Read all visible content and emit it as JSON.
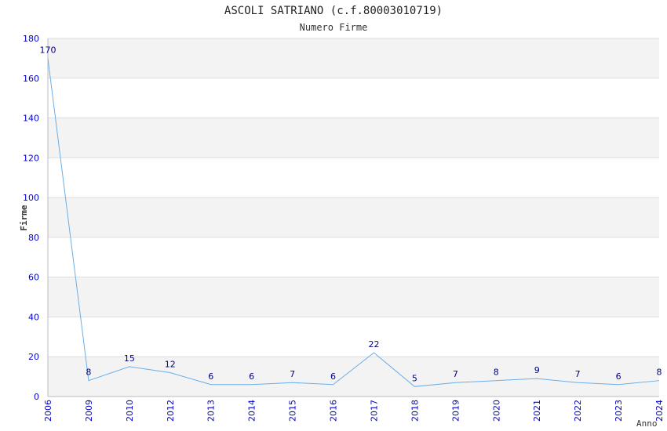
{
  "chart_data": {
    "type": "line",
    "title": "ASCOLI SATRIANO (c.f.80003010719)",
    "subtitle": "Numero Firme",
    "xlabel": "Anno",
    "ylabel": "Firme",
    "categories": [
      "2006",
      "2009",
      "2010",
      "2012",
      "2013",
      "2014",
      "2015",
      "2016",
      "2017",
      "2018",
      "2019",
      "2020",
      "2021",
      "2022",
      "2023",
      "2024"
    ],
    "values": [
      170,
      8,
      15,
      12,
      6,
      6,
      7,
      6,
      22,
      5,
      7,
      8,
      9,
      7,
      6,
      8
    ],
    "ylim": [
      0,
      180
    ],
    "yticks": [
      0,
      20,
      40,
      60,
      80,
      100,
      120,
      140,
      160,
      180
    ],
    "grid": true,
    "colors": {
      "line": "#6aaee8",
      "tick_label": "#0000cc",
      "data_label": "#000080",
      "band": "#f3f3f3",
      "gridline": "#dddddd",
      "text": "#333333"
    }
  }
}
